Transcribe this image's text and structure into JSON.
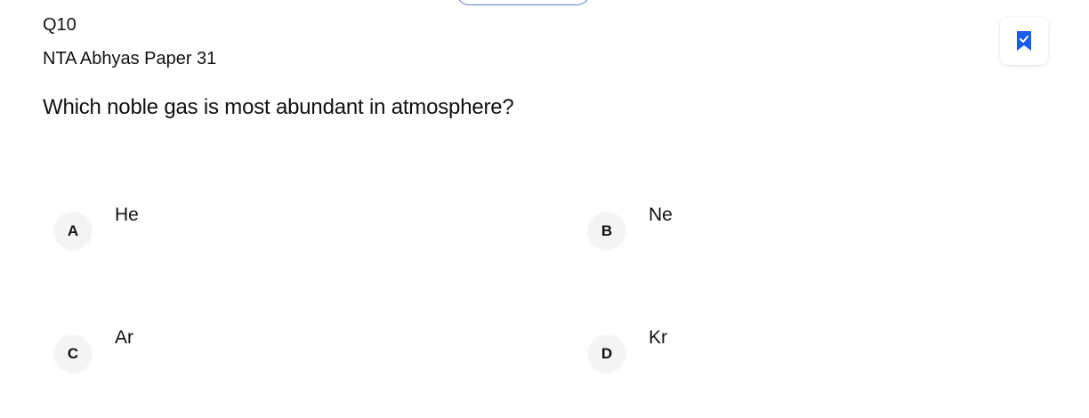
{
  "question": {
    "number": "Q10",
    "source": "NTA Abhyas Paper 31",
    "text": "Which noble gas is most abundant in atmosphere?"
  },
  "bookmark": {
    "icon": "bookmark-check-icon",
    "color": "#1a5de8"
  },
  "options": [
    {
      "letter": "A",
      "text": "He"
    },
    {
      "letter": "B",
      "text": "Ne"
    },
    {
      "letter": "C",
      "text": "Ar"
    },
    {
      "letter": "D",
      "text": "Kr"
    }
  ]
}
